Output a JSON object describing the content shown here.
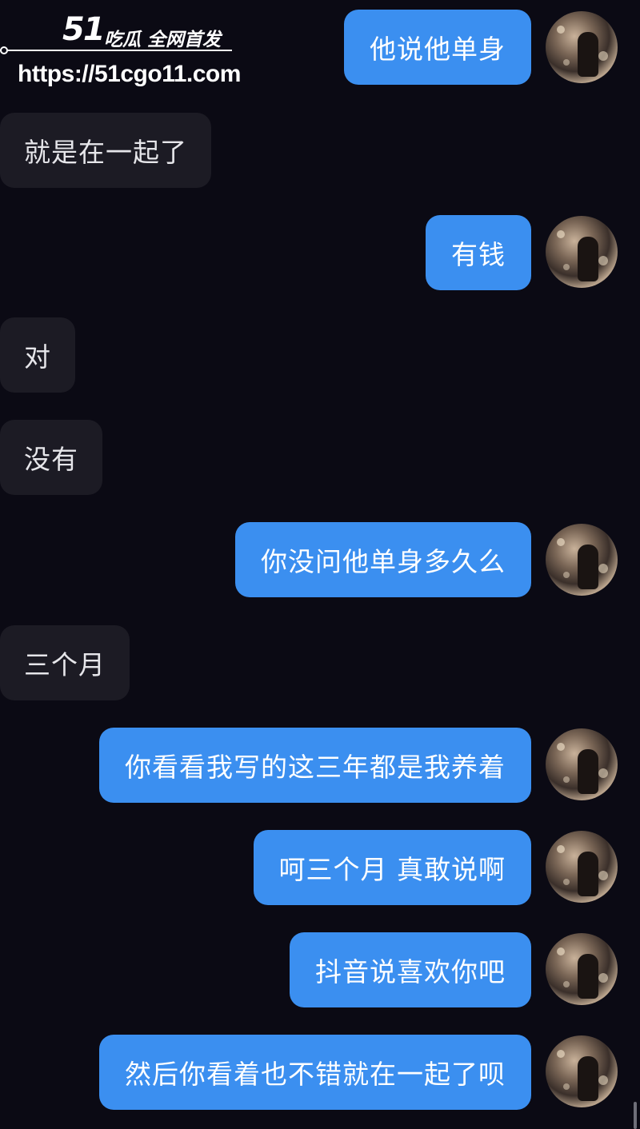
{
  "watermark": {
    "logo": "51",
    "title": "吃瓜 全网首发",
    "url": "https://51cgo11.com"
  },
  "messages": [
    {
      "side": "right",
      "text": "他说他单身"
    },
    {
      "side": "left",
      "text": "就是在一起了"
    },
    {
      "side": "right",
      "text": "有钱"
    },
    {
      "side": "left",
      "text": "对"
    },
    {
      "side": "left",
      "text": "没有"
    },
    {
      "side": "right",
      "text": "你没问他单身多久么"
    },
    {
      "side": "left",
      "text": "三个月"
    },
    {
      "side": "right",
      "text": "你看看我写的这三年都是我养着"
    },
    {
      "side": "right",
      "text": "呵三个月 真敢说啊"
    },
    {
      "side": "right",
      "text": "抖音说喜欢你吧"
    },
    {
      "side": "right",
      "text": "然后你看着也不错就在一起了呗"
    }
  ],
  "colors": {
    "background": "#0b0a14",
    "outgoing_bubble": "#3b8ff0",
    "incoming_bubble": "#1c1b24"
  }
}
